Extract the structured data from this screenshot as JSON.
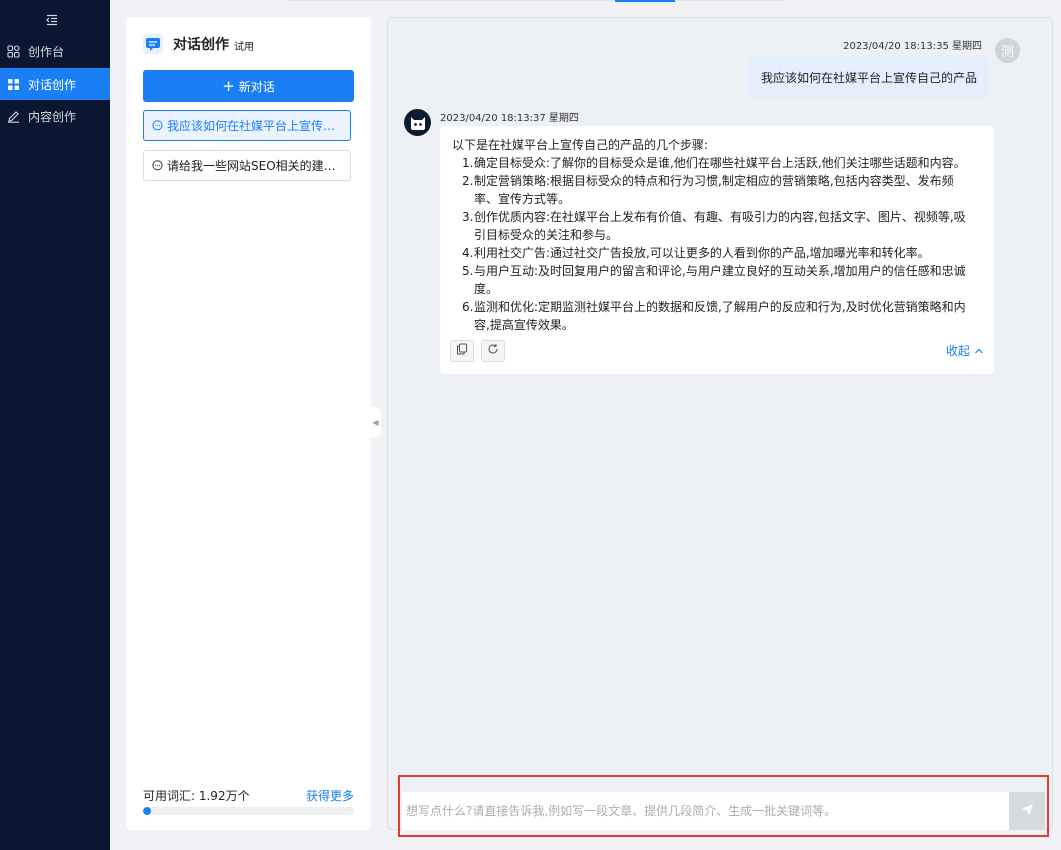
{
  "sidebar": {
    "items": [
      {
        "label": "创作台",
        "icon": "grid-icon"
      },
      {
        "label": "对话创作",
        "icon": "apps-icon",
        "active": true
      },
      {
        "label": "内容创作",
        "icon": "edit-icon"
      }
    ]
  },
  "conversations": {
    "title": "对话创作",
    "badge": "试用",
    "new_button": "新对话",
    "items": [
      {
        "label": "我应该如何在社媒平台上宣传自己的产品",
        "active": true
      },
      {
        "label": "请给我一些网站SEO相关的建议。",
        "active": false
      }
    ],
    "quota_label": "可用词汇: 1.92万个",
    "get_more": "获得更多",
    "quota_fraction": 0.04
  },
  "chat": {
    "user_message": {
      "timestamp": "2023/04/20 18:13:35 星期四",
      "avatar_char": "测",
      "text": "我应该如何在社媒平台上宣传自己的产品"
    },
    "bot_message": {
      "timestamp": "2023/04/20 18:13:37 星期四",
      "intro": "以下是在社媒平台上宣传自己的产品的几个步骤:",
      "steps": [
        {
          "num": "1.",
          "text": "确定目标受众:了解你的目标受众是谁,他们在哪些社媒平台上活跃,他们关注哪些话题和内容。"
        },
        {
          "num": "2.",
          "text": "制定营销策略:根据目标受众的特点和行为习惯,制定相应的营销策略,包括内容类型、发布频率、宣传方式等。"
        },
        {
          "num": "3.",
          "text": "创作优质内容:在社媒平台上发布有价值、有趣、有吸引力的内容,包括文字、图片、视频等,吸引目标受众的关注和参与。"
        },
        {
          "num": "4.",
          "text": "利用社交广告:通过社交广告投放,可以让更多的人看到你的产品,增加曝光率和转化率。"
        },
        {
          "num": "5.",
          "text": "与用户互动:及时回复用户的留言和评论,与用户建立良好的互动关系,增加用户的信任感和忠诚度。"
        },
        {
          "num": "6.",
          "text": "监测和优化:定期监测社媒平台上的数据和反馈,了解用户的反应和行为,及时优化营销策略和内容,提高宣传效果。"
        }
      ],
      "collapse_label": "收起"
    }
  },
  "input": {
    "placeholder": "想写点什么?请直接告诉我,例如写一段文章、提供几段简介、生成一批关键词等。",
    "value": ""
  },
  "colors": {
    "accent": "#1a7ff5",
    "sidebar_bg": "#0b1730",
    "highlight_border": "#e53935"
  }
}
